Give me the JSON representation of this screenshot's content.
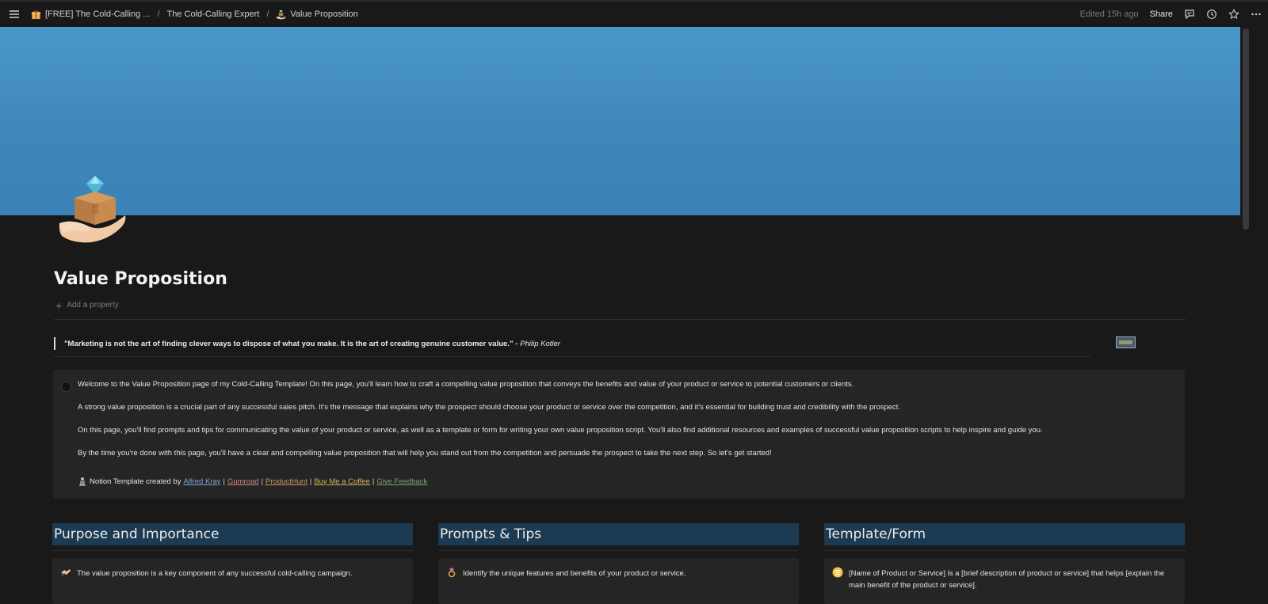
{
  "topbar": {
    "breadcrumbs": [
      {
        "label": "[FREE] The Cold-Calling ...",
        "icon": "gift-box-icon"
      },
      {
        "label": "The Cold-Calling Expert",
        "icon": ""
      },
      {
        "label": "Value Proposition",
        "icon": "hand-box-diamond-icon"
      }
    ],
    "separator": "/",
    "edited": "Edited 15h ago",
    "share_label": "Share"
  },
  "page": {
    "title": "Value Proposition",
    "add_property": "Add a property",
    "quote_text": "\"Marketing is not the art of finding clever ways to dispose of what you make. It is the art of creating genuine customer value.\" -",
    "quote_author": "Philip Kotler"
  },
  "callout": {
    "paragraphs": [
      "Welcome to the Value Proposition page of my Cold-Calling Template! On this page, you'll learn how to craft a compelling value proposition that conveys the benefits and value of your product or service to potential customers or clients.",
      "A strong value proposition is a crucial part of any successful sales pitch. It's the message that explains why the prospect should choose your product or service over the competition, and it's essential for building trust and credibility with the prospect.",
      "On this page, you'll find prompts and tips for communicating the value of your product or service, as well as a template or form for writing your own value proposition script. You'll also find additional resources and examples of successful value proposition scripts to help inspire and guide you.",
      "By the time you're done with this page, you'll have a clear and compelling value proposition that will help you stand out from the competition and persuade the prospect to take the next step. So let's get started!"
    ],
    "credit_prefix": "Notion Template created by",
    "links": {
      "author": "Alfred Kray",
      "gumroad": "Gumroad",
      "producthunt": "ProductHunt",
      "coffee": "Buy Me a Coffee",
      "feedback": "Give Feedback"
    },
    "pipe": "|"
  },
  "columns": [
    {
      "heading": "Purpose and Importance",
      "card_text": "The value proposition is a key component of any successful cold-calling campaign.",
      "icon": "handshake-icon"
    },
    {
      "heading": "Prompts & Tips",
      "card_text": "Identify the unique features and benefits of your product or service.",
      "icon": "gem-ring-icon"
    },
    {
      "heading": "Template/Form",
      "card_text": "[Name of Product or Service] is a [brief description of product or service] that helps [explain the",
      "card_text_2": "main benefit of the product or service].",
      "icon": "clipboard-list-icon"
    }
  ],
  "colors": {
    "background": "#191919",
    "cover": "#4a97cc",
    "heading_bg": "#1c3a52",
    "callout_bg": "#252525"
  }
}
